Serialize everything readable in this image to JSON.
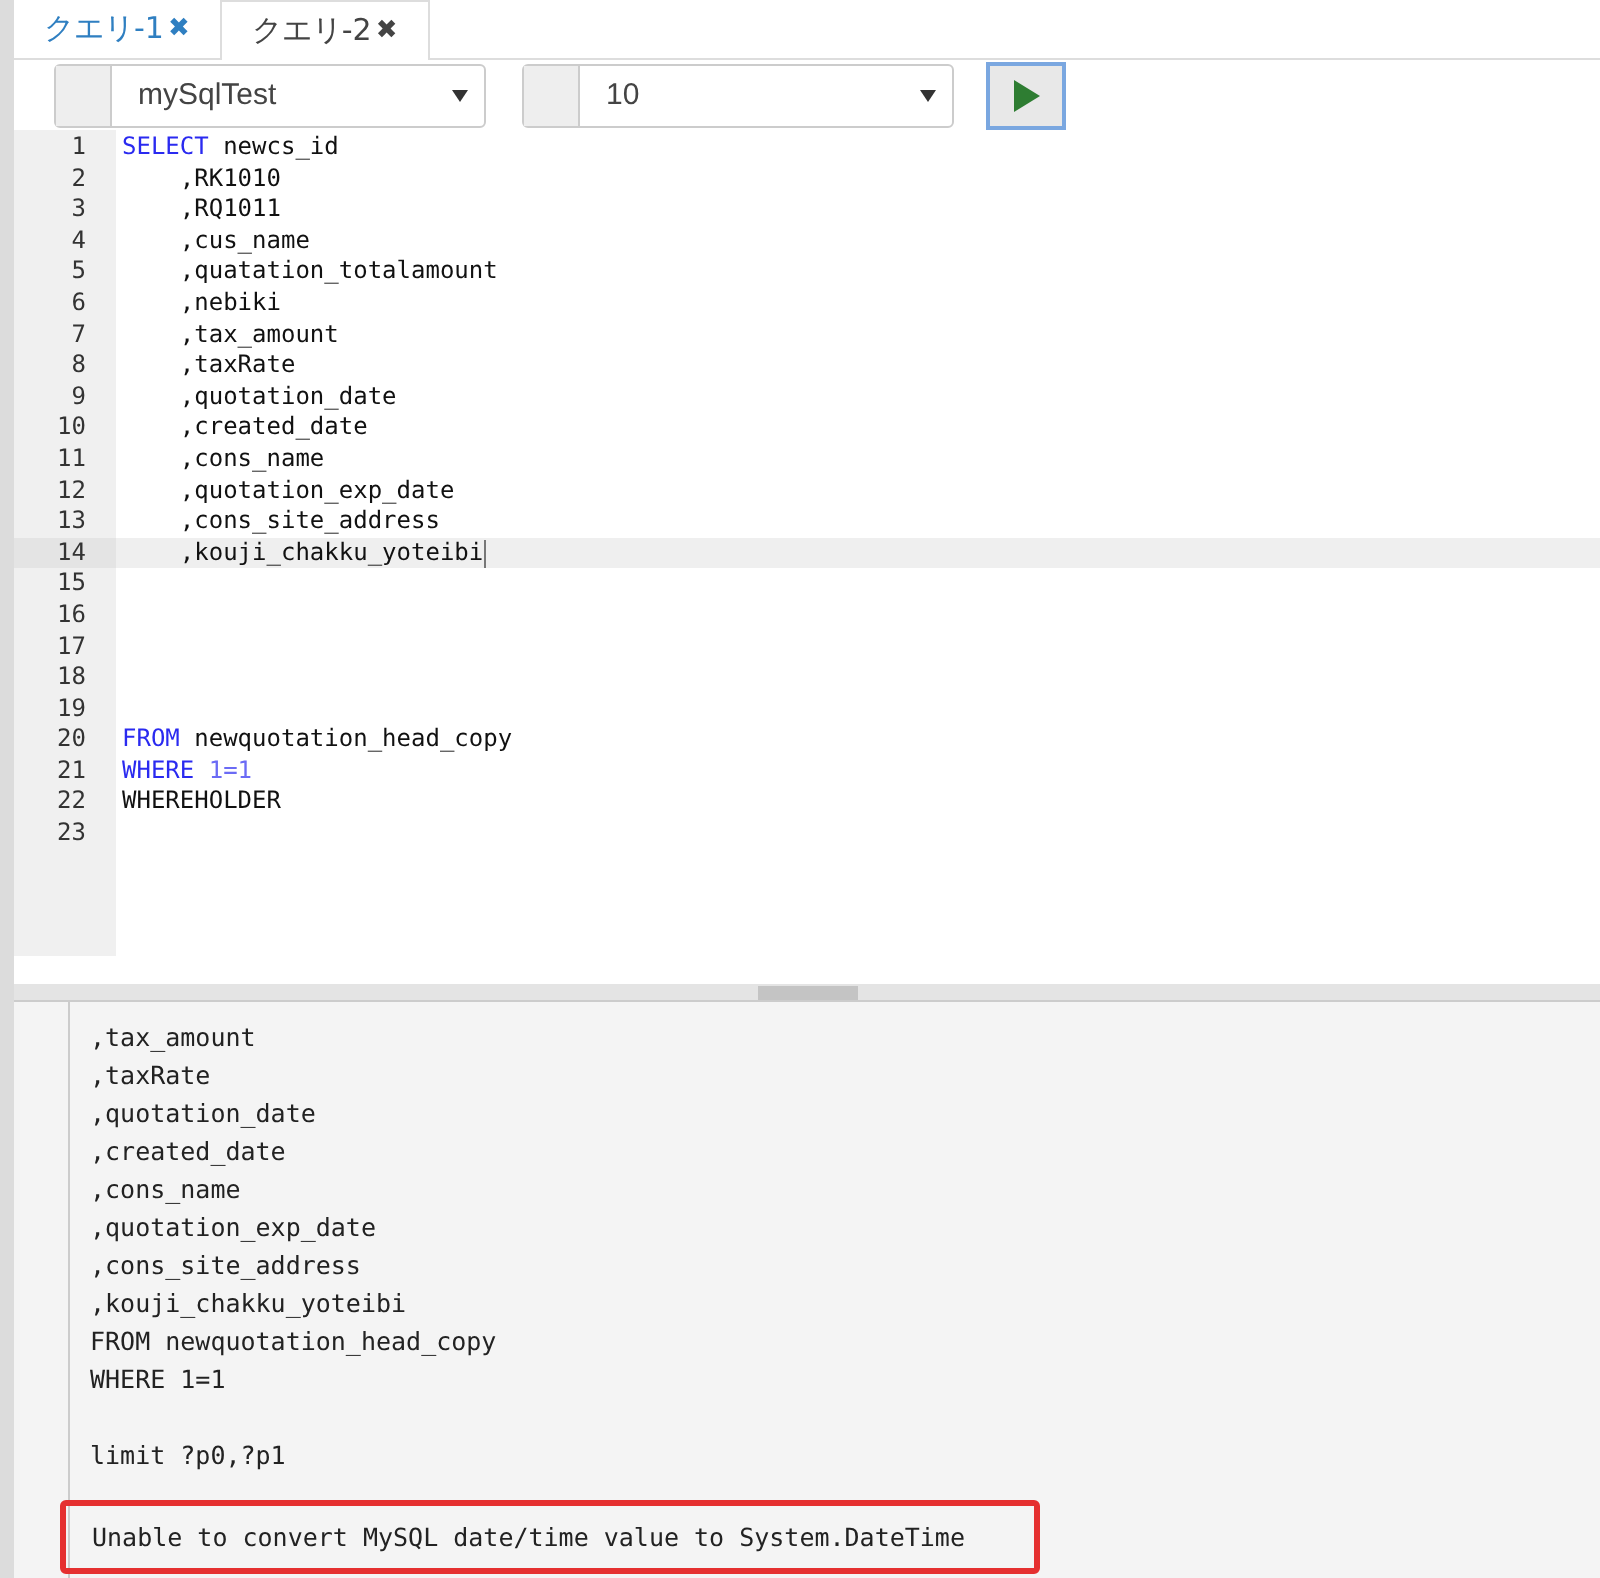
{
  "tabs": [
    {
      "label": "クエリ-1",
      "close": "✖",
      "selected": false
    },
    {
      "label": "クエリ-2",
      "close": "✖",
      "selected": true
    }
  ],
  "toolbar": {
    "connection": "mySqlTest",
    "row_limit": "10"
  },
  "editor": {
    "lines": [
      {
        "number": "1",
        "current": false,
        "segments": [
          {
            "kind": "keyword",
            "text": "SELECT"
          },
          {
            "kind": "text",
            "text": " newcs_id"
          }
        ]
      },
      {
        "number": "2",
        "current": false,
        "segments": [
          {
            "kind": "text",
            "text": "    ,RK1010"
          }
        ]
      },
      {
        "number": "3",
        "current": false,
        "segments": [
          {
            "kind": "text",
            "text": "    ,RQ1011"
          }
        ]
      },
      {
        "number": "4",
        "current": false,
        "segments": [
          {
            "kind": "text",
            "text": "    ,cus_name"
          }
        ]
      },
      {
        "number": "5",
        "current": false,
        "segments": [
          {
            "kind": "text",
            "text": "    ,quatation_totalamount"
          }
        ]
      },
      {
        "number": "6",
        "current": false,
        "segments": [
          {
            "kind": "text",
            "text": "    ,nebiki"
          }
        ]
      },
      {
        "number": "7",
        "current": false,
        "segments": [
          {
            "kind": "text",
            "text": "    ,tax_amount"
          }
        ]
      },
      {
        "number": "8",
        "current": false,
        "segments": [
          {
            "kind": "text",
            "text": "    ,taxRate"
          }
        ]
      },
      {
        "number": "9",
        "current": false,
        "segments": [
          {
            "kind": "text",
            "text": "    ,quotation_date"
          }
        ]
      },
      {
        "number": "10",
        "current": false,
        "segments": [
          {
            "kind": "text",
            "text": "    ,created_date"
          }
        ]
      },
      {
        "number": "11",
        "current": false,
        "segments": [
          {
            "kind": "text",
            "text": "    ,cons_name"
          }
        ]
      },
      {
        "number": "12",
        "current": false,
        "segments": [
          {
            "kind": "text",
            "text": "    ,quotation_exp_date"
          }
        ]
      },
      {
        "number": "13",
        "current": false,
        "segments": [
          {
            "kind": "text",
            "text": "    ,cons_site_address"
          }
        ]
      },
      {
        "number": "14",
        "current": true,
        "segments": [
          {
            "kind": "text",
            "text": "    ,kouji_chakku_yoteibi"
          }
        ]
      },
      {
        "number": "15",
        "current": false
      },
      {
        "number": "16",
        "current": false
      },
      {
        "number": "17",
        "current": false
      },
      {
        "number": "18",
        "current": false
      },
      {
        "number": "19",
        "current": false
      },
      {
        "number": "20",
        "current": false,
        "segments": [
          {
            "kind": "keyword",
            "text": "FROM"
          },
          {
            "kind": "text",
            "text": " newquotation_head_copy"
          }
        ]
      },
      {
        "number": "21",
        "current": false,
        "segments": [
          {
            "kind": "keyword",
            "text": "WHERE"
          },
          {
            "kind": "number",
            "text": " 1=1"
          }
        ]
      },
      {
        "number": "22",
        "current": false,
        "segments": [
          {
            "kind": "text",
            "text": "WHEREHOLDER"
          }
        ]
      },
      {
        "number": "23",
        "current": false
      }
    ]
  },
  "output": {
    "lines": [
      ",tax_amount",
      ",taxRate",
      ",quotation_date",
      ",created_date",
      ",cons_name",
      ",quotation_exp_date",
      ",cons_site_address",
      ",kouji_chakku_yoteibi",
      "FROM newquotation_head_copy",
      "WHERE 1=1"
    ],
    "limit_line": "limit ?p0,?p1",
    "error": "Unable to convert MySQL date/time value to System.DateTime"
  }
}
